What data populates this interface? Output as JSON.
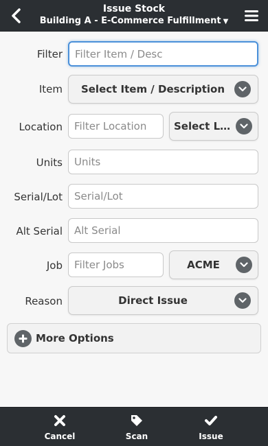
{
  "header": {
    "title": "Issue Stock",
    "subtitle": "Building A - E-Commerce Fulfillment"
  },
  "form": {
    "filter": {
      "label": "Filter",
      "placeholder": "Filter Item / Desc",
      "value": ""
    },
    "item": {
      "label": "Item",
      "selected": "Select Item / Description"
    },
    "location": {
      "label": "Location",
      "placeholder": "Filter Location",
      "selected": "Select Location"
    },
    "units": {
      "label": "Units",
      "placeholder": "Units"
    },
    "serial_lot": {
      "label": "Serial/Lot",
      "placeholder": "Serial/Lot"
    },
    "alt_serial": {
      "label": "Alt Serial",
      "placeholder": "Alt Serial"
    },
    "job": {
      "label": "Job",
      "placeholder": "Filter Jobs",
      "selected": "ACME"
    },
    "reason": {
      "label": "Reason",
      "selected": "Direct Issue"
    }
  },
  "more_options": {
    "label": "More Options"
  },
  "footer": {
    "cancel": "Cancel",
    "scan": "Scan",
    "issue": "Issue"
  },
  "icons": {
    "back": "chevron-left-icon",
    "menu": "hamburger-menu-icon",
    "dropdown": "chevron-down-circle-icon",
    "plus": "plus-circle-icon",
    "cancel": "x-icon",
    "scan": "tag-icon",
    "issue": "checkmark-icon"
  },
  "colors": {
    "header_bg": "#2b2f33",
    "page_bg": "#f7f7f7",
    "focus": "#4a90d9",
    "icon_circle": "#5f6468"
  }
}
